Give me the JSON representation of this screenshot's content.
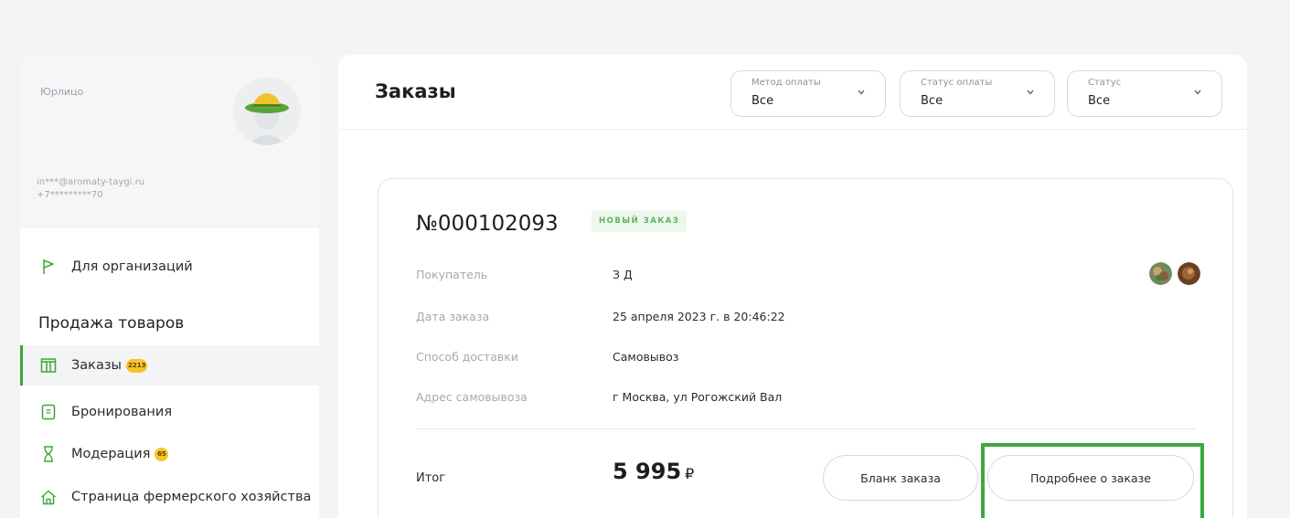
{
  "profile": {
    "type_label": "Юрлицо",
    "email": "in***@aromaty-taygi.ru",
    "phone": "+7*********70"
  },
  "sidebar": {
    "org_link": "Для организаций",
    "section_title": "Продажа товаров",
    "items": [
      {
        "label": "Заказы",
        "badge": "2213",
        "icon": "orders-icon",
        "active": true
      },
      {
        "label": "Бронирования",
        "icon": "booking-icon",
        "active": false
      },
      {
        "label": "Модерация",
        "badge": "65",
        "icon": "hourglass-icon",
        "active": false
      },
      {
        "label": "Страница фермерского хозяйства",
        "icon": "farm-home-icon",
        "active": false
      }
    ]
  },
  "main": {
    "title": "Заказы",
    "filters": [
      {
        "label": "Метод оплаты",
        "value": "Все"
      },
      {
        "label": "Статус оплаты",
        "value": "Все"
      },
      {
        "label": "Статус",
        "value": "Все"
      }
    ]
  },
  "order": {
    "number": "№000102093",
    "status": "НОВЫЙ ЗАКАЗ",
    "rows": [
      {
        "label": "Покупатель",
        "value": "З        Д"
      },
      {
        "label": "Дата заказа",
        "value": "25 апреля 2023 г. в 20:46:22"
      },
      {
        "label": "Способ доставки",
        "value": "Самовывоз"
      },
      {
        "label": "Адрес самовывоза",
        "value": "г Москва, ул Рогожский Вал"
      }
    ],
    "total_label": "Итог",
    "total_value": "5 995",
    "currency": "₽",
    "blank_button": "Бланк заказа",
    "details_button": "Подробнее о заказе"
  },
  "colors": {
    "accent": "#3fa535",
    "highlight": "#3da93d",
    "badge": "#f6c42a",
    "status_badge_bg": "#eef7ee",
    "status_badge_text": "#5bb45b"
  }
}
